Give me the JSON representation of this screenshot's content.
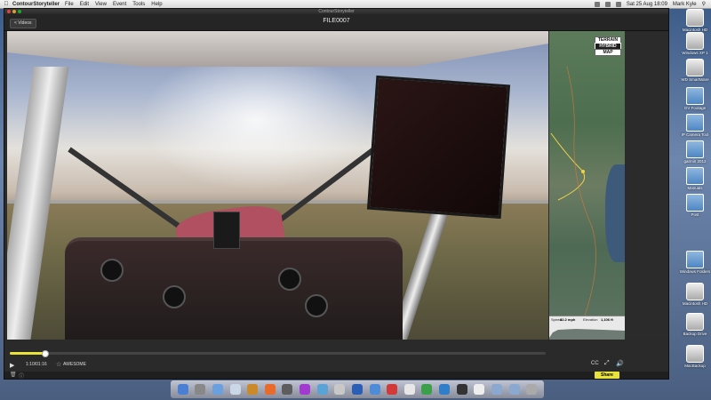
{
  "menubar": {
    "app_name": "ContourStoryteller",
    "menus": [
      "File",
      "Edit",
      "View",
      "Event",
      "Tools",
      "Help"
    ],
    "clock": "Sat 25 Aug 18:09",
    "user": "Mark Kyle"
  },
  "window": {
    "title": "ContourStoryteller",
    "back_label": "< Videos",
    "file_title": "FILE0007"
  },
  "map": {
    "buttons": [
      "TERRAIN",
      "HYBRID",
      "MAP"
    ],
    "active_button": "HYBRID",
    "speed_label": "Speed",
    "speed_value": "82.2 mph",
    "elevation_label": "Elevation",
    "elevation_value": "1,106 ft"
  },
  "controls": {
    "time": "1:10/01:16",
    "awesome_label": "AWESOME",
    "progress_fraction": 0.065,
    "share_label": "Share",
    "cc_label": "CC"
  },
  "desktop": {
    "icons": [
      "Macintosh HD",
      "Windows XP 1",
      "WD SmartWare",
      "GV Footage",
      "IP Camera Tool",
      "garmin 2012",
      "Manuals",
      "Post",
      "Windows Folders",
      "Macintosh HD",
      "Backup Drive",
      "MacBackup"
    ]
  },
  "colors": {
    "accent": "#e8e23a",
    "window_bg": "#2b2b2b"
  }
}
